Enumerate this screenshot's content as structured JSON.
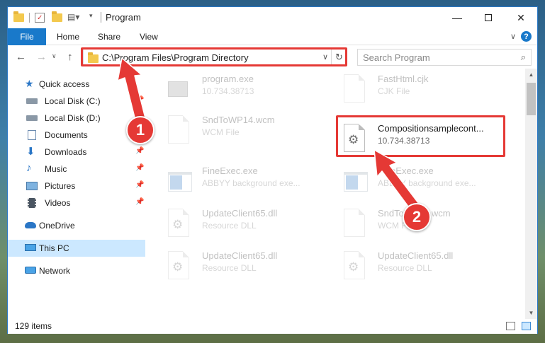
{
  "window": {
    "title": "Program"
  },
  "ribbon": {
    "tabs": [
      {
        "label": "File"
      },
      {
        "label": "Home"
      },
      {
        "label": "Share"
      },
      {
        "label": "View"
      }
    ],
    "help": "?"
  },
  "address": {
    "path": "C:\\Program Files\\Program Directory"
  },
  "search": {
    "placeholder": "Search Program"
  },
  "sidebar": {
    "items": [
      {
        "label": "Quick access",
        "icon": "star-icon"
      },
      {
        "label": "Local Disk (C:)",
        "icon": "drive-icon",
        "pinned": true
      },
      {
        "label": "Local Disk (D:)",
        "icon": "drive-icon",
        "pinned": false
      },
      {
        "label": "Documents",
        "icon": "documents-icon",
        "pinned": true
      },
      {
        "label": "Downloads",
        "icon": "downloads-icon",
        "pinned": true
      },
      {
        "label": "Music",
        "icon": "music-icon",
        "pinned": true
      },
      {
        "label": "Pictures",
        "icon": "pictures-icon",
        "pinned": true
      },
      {
        "label": "Videos",
        "icon": "videos-icon",
        "pinned": true
      },
      {
        "label": "OneDrive",
        "icon": "cloud-icon"
      },
      {
        "label": "This PC",
        "icon": "computer-icon",
        "selected": true
      },
      {
        "label": "Network",
        "icon": "network-icon"
      }
    ]
  },
  "files": [
    {
      "name": "program.exe",
      "sub": "10.734.38713",
      "icon": "installer-icon"
    },
    {
      "name": "FastHtml.cjk",
      "sub": "CJK File",
      "icon": "document-icon"
    },
    {
      "name": "SndToWP14.wcm",
      "sub": "WCM File",
      "icon": "document-icon"
    },
    {
      "name": "Compositionsamplecont...",
      "sub": "10.734.38713",
      "icon": "settings-file-icon"
    },
    {
      "name": "FineExec.exe",
      "sub": "ABBYY background exe...",
      "icon": "application-icon"
    },
    {
      "name": "FineExec.exe",
      "sub": "ABBYY background exe...",
      "icon": "application-icon"
    },
    {
      "name": "UpdateClient65.dll",
      "sub": "Resource DLL",
      "icon": "settings-file-icon"
    },
    {
      "name": "SndToWP14.wcm",
      "sub": "WCM File",
      "icon": "document-icon"
    },
    {
      "name": "UpdateClient65.dll",
      "sub": "Resource DLL",
      "icon": "settings-file-icon"
    },
    {
      "name": "UpdateClient65.dll",
      "sub": "Resource DLL",
      "icon": "settings-file-icon"
    }
  ],
  "status": {
    "count": "129 items"
  },
  "annotations": {
    "step1": "1",
    "step2": "2",
    "color": "#e53935"
  },
  "colors": {
    "accent": "#1979ca",
    "selection": "#cce8ff"
  }
}
